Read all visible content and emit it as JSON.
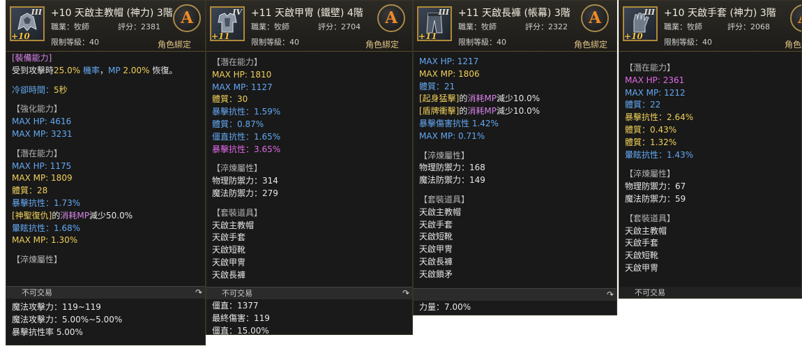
{
  "panel1": {
    "title": "+10 天啟主教帽 (神力) 3階",
    "job": "職業：牧師",
    "score": "評分：2381",
    "level": "限制等級：40",
    "bind": "角色綁定",
    "grade": "A",
    "tier": "III",
    "plus": "+10",
    "lines": [
      "[裝備能力]",
      "受到攻擊時25.0% 機率，MP 2.00% 恢復。",
      "",
      "冷卻時間：5秒",
      "",
      "【強化能力】",
      "MAX HP:  4616",
      "MAX MP:  3231",
      "",
      "【潛在能力】",
      "MAX HP:  1175",
      "MAX MP:  1809",
      "體質：28",
      "暴擊抗性：1.73%",
      "[神聖復仇]的消耗MP減少50.0%",
      "暈眩抗性：1.68%",
      "MAX MP:  1.30%",
      "",
      "【淬煉屬性】"
    ],
    "footer": "不可交易",
    "below": [
      "魔法攻擊力：119~119",
      "魔法攻擊力：5.00%~5.00%",
      "暴擊抗性率 5.00%"
    ]
  },
  "panel2": {
    "title": "+11 天啟甲冑 (鐵壁) 4階",
    "job": "職業：牧師",
    "score": "評分：2704",
    "level": "限制等級：40",
    "bind": "角色綁定",
    "grade": "A",
    "tier": "IV",
    "plus": "+11",
    "lines": [
      "【潛在能力】",
      "MAX HP:  1810",
      "MAX MP:  1127",
      "體質：30",
      "暴擊抗性：1.59%",
      "體質：0.87%",
      "僵直抗性：1.65%",
      "暴擊抗性：3.65%",
      "",
      "【淬煉屬性】",
      "物理防禦力：314",
      "魔法防禦力：279",
      "",
      "【套裝道具】",
      "天啟主教帽",
      "天啟手套",
      "天啟短靴",
      "天啟甲冑",
      "天啟長褲"
    ],
    "footer": "不可交易",
    "below": [
      "僵直：1377",
      "最終傷害：119",
      "僵直：15.00%"
    ]
  },
  "panel3": {
    "title": "+11 天啟長褲 (帳幕) 3階",
    "job": "職業：牧師",
    "score": "評分：2322",
    "level": "限制等級：40",
    "bind": "角色綁定",
    "grade": "A",
    "tier": "III",
    "plus": "+11",
    "lines": [
      "MAX HP:  1217",
      "MAX MP:  1806",
      "體質：21",
      "[起身猛擊]的消耗MP減少10.0%",
      "[盾牌衝擊]的消耗MP減少10.0%",
      "暴擊傷害抗性 1.42%",
      "MAX MP:  0.71%",
      "",
      "【淬煉屬性】",
      "物理防禦力：168",
      "魔法防禦力：149",
      "",
      "【套裝道具】",
      "天啟主教帽",
      "天啟手套",
      "天啟短靴",
      "天啟甲冑",
      "天啟長褲",
      "天啟鎖矛"
    ],
    "footer": "",
    "below": [
      "力量：7.00%"
    ]
  },
  "panel4": {
    "title": "+10 天啟手套 (神力) 3階",
    "job": "職業：牧師",
    "score": "評分：2068",
    "level": "限制等級：40",
    "bind": "角色綁定",
    "grade": "A",
    "tier": "III",
    "plus": "+10",
    "lines": [
      "【潛在能力】",
      "MAX HP:  2361",
      "MAX MP:  1212",
      "體質：22",
      "暴擊抗性：2.64%",
      "體質：0.43%",
      "體質：1.32%",
      "暈眩抗性：1.43%",
      "",
      "【淬煉屬性】",
      "物理防禦力：67",
      "魔法防禦力：59",
      "",
      "【套裝道具】",
      "天啟主教帽",
      "天啟手套",
      "天啟短靴",
      "天啟甲冑"
    ],
    "footer": "不可交易",
    "below": []
  }
}
